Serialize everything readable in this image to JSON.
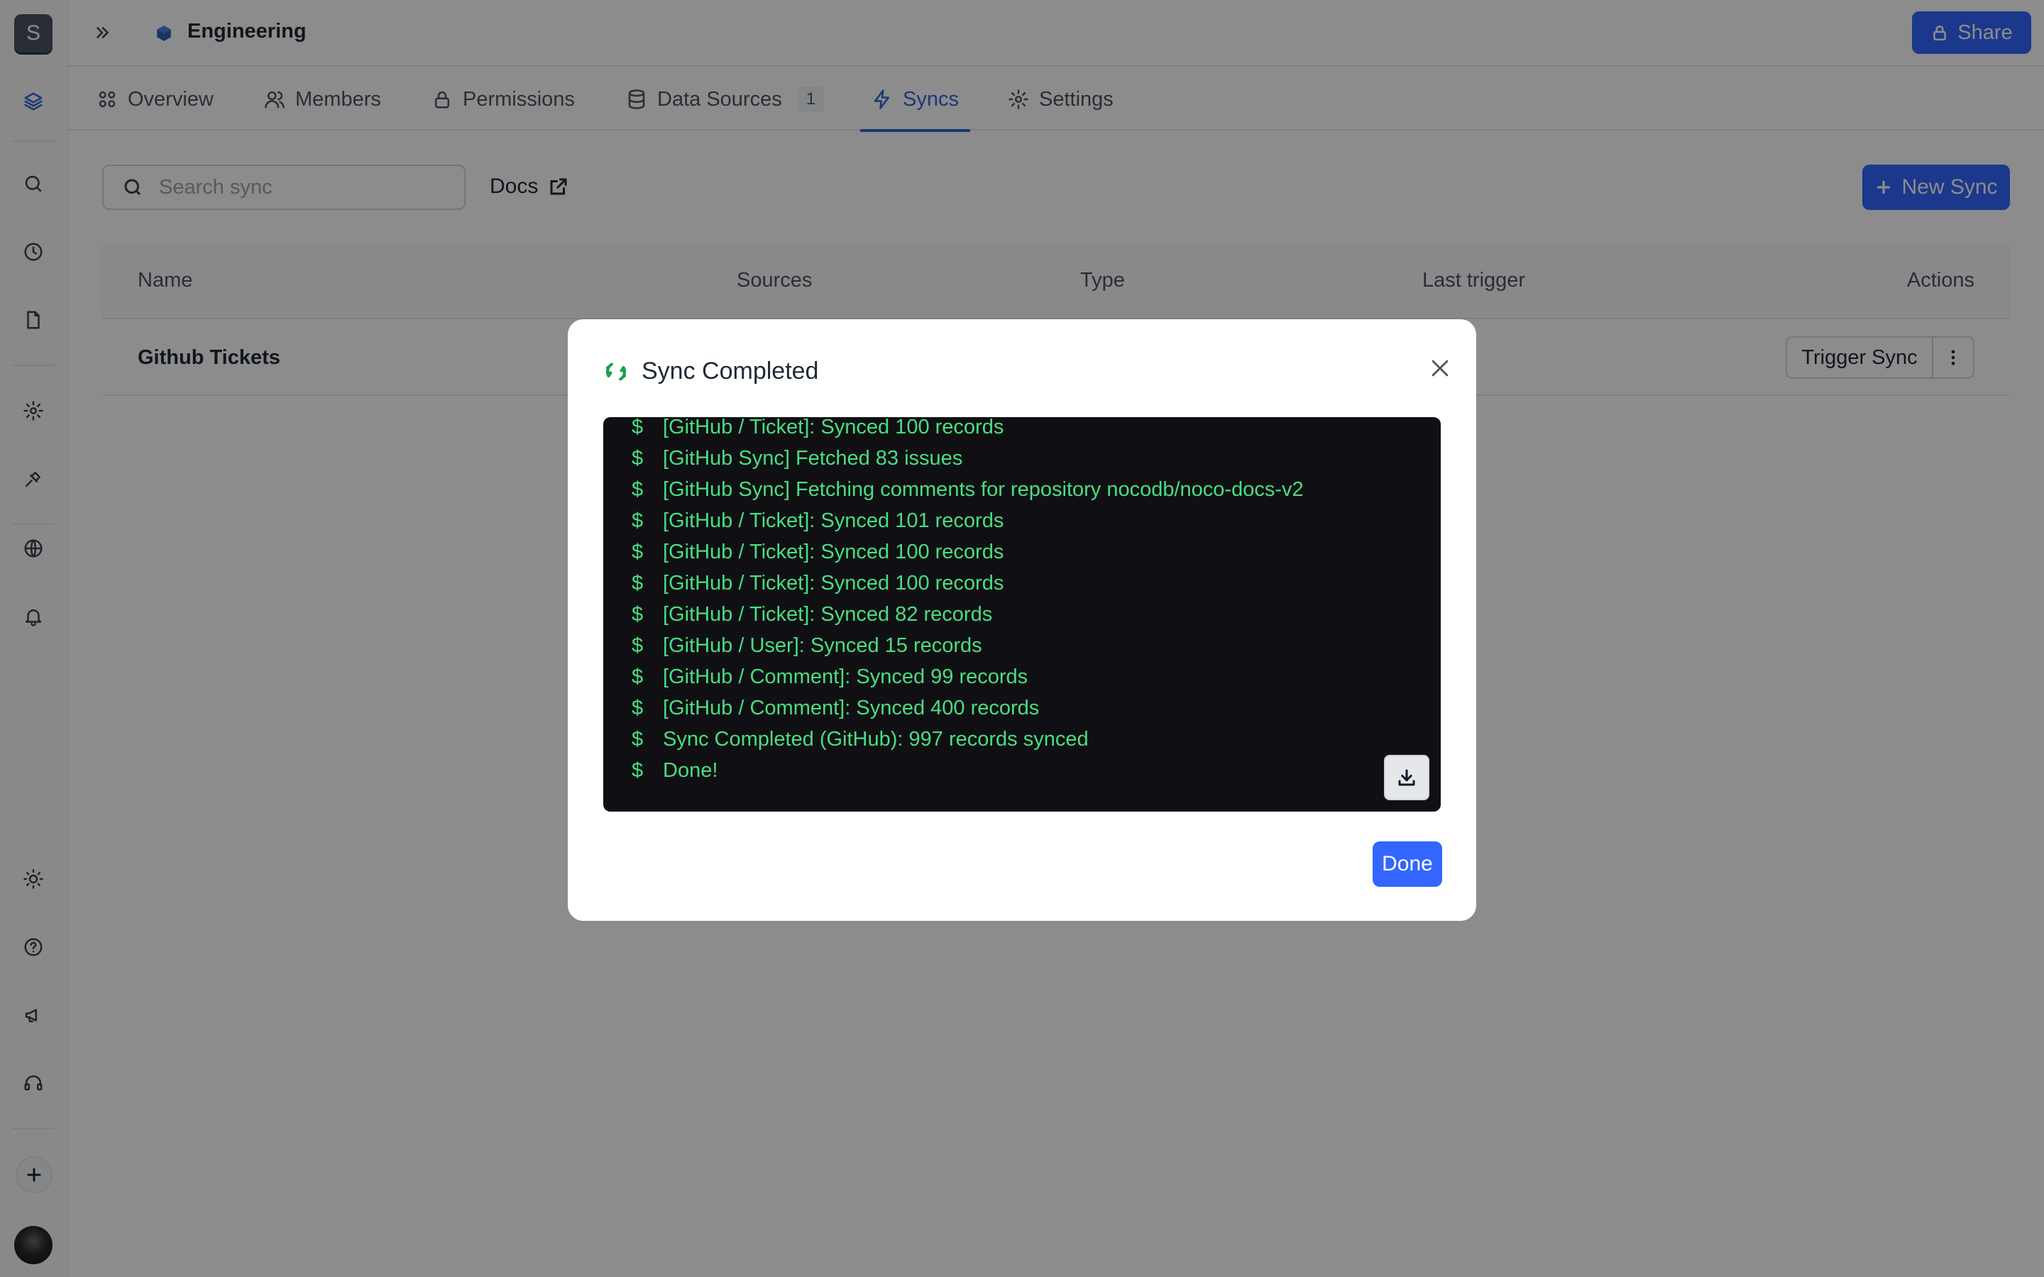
{
  "workspace": {
    "initial": "S"
  },
  "topbar": {
    "title": "Engineering",
    "share_label": "Share",
    "brand_color": "#3366ff"
  },
  "tabs": [
    {
      "label": "Overview",
      "icon": "grid-icon"
    },
    {
      "label": "Members",
      "icon": "users-icon"
    },
    {
      "label": "Permissions",
      "icon": "lock-icon"
    },
    {
      "label": "Data Sources",
      "icon": "database-icon",
      "count": "1"
    },
    {
      "label": "Syncs",
      "icon": "zap-icon",
      "active": true
    },
    {
      "label": "Settings",
      "icon": "gear-icon"
    }
  ],
  "toolbar": {
    "search_placeholder": "Search sync",
    "docs_label": "Docs",
    "new_sync_label": "New Sync"
  },
  "table": {
    "headers": [
      "Name",
      "Sources",
      "Type",
      "Last trigger",
      "Actions"
    ],
    "rows": [
      {
        "name": "Github Tickets",
        "trigger_label": "Trigger Sync"
      }
    ]
  },
  "modal": {
    "title": "Sync Completed",
    "prompt_symbol": "$",
    "log_lines": [
      "[GitHub / Ticket]: Synced 100 records",
      "[GitHub Sync] Fetched 83 issues",
      "[GitHub Sync] Fetching comments for repository nocodb/noco-docs-v2",
      "[GitHub / Ticket]: Synced 101 records",
      "[GitHub / Ticket]: Synced 100 records",
      "[GitHub / Ticket]: Synced 100 records",
      "[GitHub / Ticket]: Synced 82 records",
      "[GitHub / User]: Synced 15 records",
      "[GitHub / Comment]: Synced 99 records",
      "[GitHub / Comment]: Synced 400 records",
      "Sync Completed (GitHub): 997 records synced",
      "Done!"
    ],
    "done_label": "Done",
    "log_text_color": "#4ade80"
  }
}
